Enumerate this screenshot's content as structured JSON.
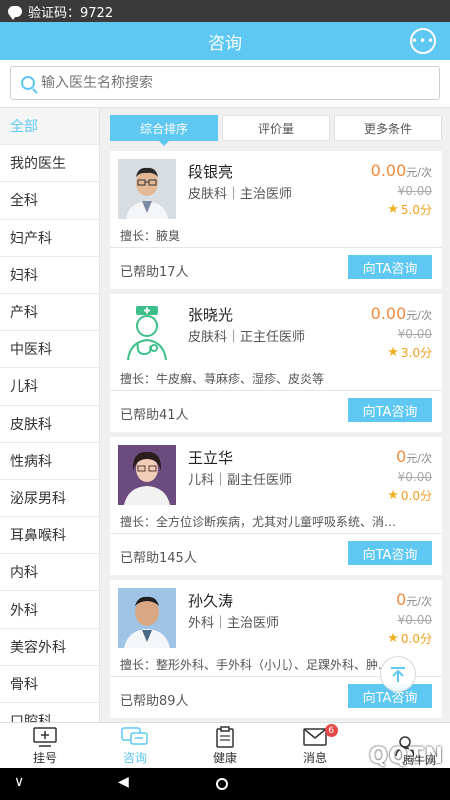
{
  "status": {
    "text": "验证码：9722"
  },
  "header": {
    "title": "咨询"
  },
  "search": {
    "placeholder": "输入医生名称搜索"
  },
  "sidebar": {
    "items": [
      {
        "label": "全部",
        "active": true
      },
      {
        "label": "我的医生"
      },
      {
        "label": "全科"
      },
      {
        "label": "妇产科"
      },
      {
        "label": "妇科"
      },
      {
        "label": "产科"
      },
      {
        "label": "中医科"
      },
      {
        "label": "儿科"
      },
      {
        "label": "皮肤科"
      },
      {
        "label": "性病科"
      },
      {
        "label": "泌尿男科"
      },
      {
        "label": "耳鼻喉科"
      },
      {
        "label": "内科"
      },
      {
        "label": "外科"
      },
      {
        "label": "美容外科"
      },
      {
        "label": "骨科"
      },
      {
        "label": "口腔科"
      }
    ]
  },
  "filters": [
    {
      "label": "综合排序",
      "active": true
    },
    {
      "label": "评价量"
    },
    {
      "label": "更多条件"
    }
  ],
  "doctors": [
    {
      "name": "段银亮",
      "dept": "皮肤科｜主治医师",
      "price": "0.00",
      "unit": "元/次",
      "orig": "¥0.00",
      "rating": "5.0分",
      "specialty": "擅长：腋臭",
      "helped": "已帮助17人",
      "consult": "向TA咨询",
      "avatar": "photo-man-glasses"
    },
    {
      "name": "张晓光",
      "dept": "皮肤科｜正主任医师",
      "price": "0.00",
      "unit": "元/次",
      "orig": "¥0.00",
      "rating": "3.0分",
      "specialty": "擅长：牛皮癣、荨麻疹、湿疹、皮炎等",
      "helped": "已帮助41人",
      "consult": "向TA咨询",
      "avatar": "stethoscope-placeholder"
    },
    {
      "name": "王立华",
      "dept": "儿科｜副主任医师",
      "price": "0",
      "unit": "元/次",
      "orig": "¥0.00",
      "rating": "0.0分",
      "specialty": "擅长：全方位诊断疾病，尤其对儿童呼吸系统、消…",
      "helped": "已帮助145人",
      "consult": "向TA咨询",
      "avatar": "photo-woman"
    },
    {
      "name": "孙久涛",
      "dept": "外科｜主治医师",
      "price": "0",
      "unit": "元/次",
      "orig": "¥0.00",
      "rating": "0.0分",
      "specialty": "擅长：整形外科、手外科（小儿）、足踝外科、肿…",
      "helped": "已帮助89人",
      "consult": "向TA咨询",
      "avatar": "photo-man"
    }
  ],
  "tabs": [
    {
      "label": "挂号",
      "icon": "monitor-plus-icon"
    },
    {
      "label": "咨询",
      "icon": "chat-bubbles-icon",
      "active": true
    },
    {
      "label": "健康",
      "icon": "clipboard-icon"
    },
    {
      "label": "消息",
      "icon": "envelope-icon",
      "badge": "6"
    },
    {
      "label": "",
      "icon": "person-icon"
    }
  ],
  "watermark": {
    "brand": "QQTN",
    "cn": "腾牛网"
  },
  "colors": {
    "accent": "#5ec8f2",
    "price": "#f08a3c",
    "star": "#f0b020",
    "badge": "#e54848"
  }
}
